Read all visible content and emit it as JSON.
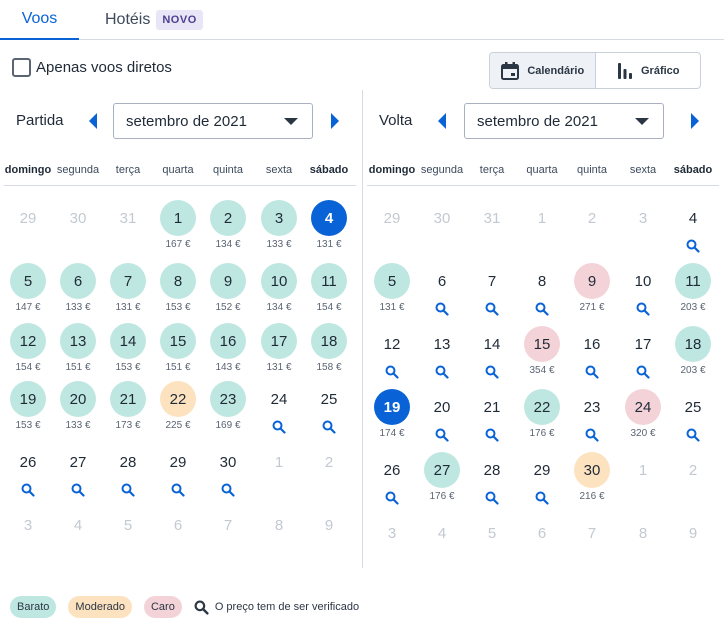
{
  "tabs": [
    {
      "label": "Voos",
      "active": true
    },
    {
      "label": "Hotéis",
      "badge": "NOVO",
      "active": false
    }
  ],
  "filters": {
    "direct_only_label": "Apenas voos diretos",
    "direct_only_checked": false
  },
  "view_toggle": [
    {
      "label": "Calendário",
      "icon": "calendar-icon",
      "active": true
    },
    {
      "label": "Gráfico",
      "icon": "bar-chart-icon",
      "active": false
    }
  ],
  "weekdays": [
    "domingo",
    "segunda",
    "terça",
    "quarta",
    "quinta",
    "sexta",
    "sábado"
  ],
  "departure": {
    "label": "Partida",
    "month": "setembro de 2021",
    "weeks": [
      [
        {
          "d": "29",
          "out": true
        },
        {
          "d": "30",
          "out": true
        },
        {
          "d": "31",
          "out": true
        },
        {
          "d": "1",
          "p": "167 €",
          "c": "cheap"
        },
        {
          "d": "2",
          "p": "134 €",
          "c": "cheap"
        },
        {
          "d": "3",
          "p": "133 €",
          "c": "cheap"
        },
        {
          "d": "4",
          "p": "131 €",
          "c": "selected"
        }
      ],
      [
        {
          "d": "5",
          "p": "147 €",
          "c": "cheap"
        },
        {
          "d": "6",
          "p": "133 €",
          "c": "cheap"
        },
        {
          "d": "7",
          "p": "131 €",
          "c": "cheap"
        },
        {
          "d": "8",
          "p": "153 €",
          "c": "cheap"
        },
        {
          "d": "9",
          "p": "152 €",
          "c": "cheap"
        },
        {
          "d": "10",
          "p": "134 €",
          "c": "cheap"
        },
        {
          "d": "11",
          "p": "154 €",
          "c": "cheap"
        }
      ],
      [
        {
          "d": "12",
          "p": "154 €",
          "c": "cheap"
        },
        {
          "d": "13",
          "p": "151 €",
          "c": "cheap"
        },
        {
          "d": "14",
          "p": "153 €",
          "c": "cheap"
        },
        {
          "d": "15",
          "p": "151 €",
          "c": "cheap"
        },
        {
          "d": "16",
          "p": "143 €",
          "c": "cheap"
        },
        {
          "d": "17",
          "p": "131 €",
          "c": "cheap"
        },
        {
          "d": "18",
          "p": "158 €",
          "c": "cheap"
        }
      ],
      [
        {
          "d": "19",
          "p": "153 €",
          "c": "cheap"
        },
        {
          "d": "20",
          "p": "133 €",
          "c": "cheap"
        },
        {
          "d": "21",
          "p": "173 €",
          "c": "cheap"
        },
        {
          "d": "22",
          "p": "225 €",
          "c": "moderate"
        },
        {
          "d": "23",
          "p": "169 €",
          "c": "cheap"
        },
        {
          "d": "24",
          "s": true
        },
        {
          "d": "25",
          "s": true
        }
      ],
      [
        {
          "d": "26",
          "s": true
        },
        {
          "d": "27",
          "s": true
        },
        {
          "d": "28",
          "s": true
        },
        {
          "d": "29",
          "s": true
        },
        {
          "d": "30",
          "s": true
        },
        {
          "d": "1",
          "out": true
        },
        {
          "d": "2",
          "out": true
        }
      ],
      [
        {
          "d": "3",
          "out": true
        },
        {
          "d": "4",
          "out": true
        },
        {
          "d": "5",
          "out": true
        },
        {
          "d": "6",
          "out": true
        },
        {
          "d": "7",
          "out": true
        },
        {
          "d": "8",
          "out": true
        },
        {
          "d": "9",
          "out": true
        }
      ]
    ]
  },
  "return": {
    "label": "Volta",
    "month": "setembro de 2021",
    "weeks": [
      [
        {
          "d": "29",
          "out": true
        },
        {
          "d": "30",
          "out": true
        },
        {
          "d": "31",
          "out": true
        },
        {
          "d": "1",
          "out": true
        },
        {
          "d": "2",
          "out": true
        },
        {
          "d": "3",
          "out": true
        },
        {
          "d": "4",
          "s": true
        }
      ],
      [
        {
          "d": "5",
          "p": "131 €",
          "c": "cheap"
        },
        {
          "d": "6",
          "s": true
        },
        {
          "d": "7",
          "s": true
        },
        {
          "d": "8",
          "s": true
        },
        {
          "d": "9",
          "p": "271 €",
          "c": "expensive"
        },
        {
          "d": "10",
          "s": true
        },
        {
          "d": "11",
          "p": "203 €",
          "c": "cheap"
        }
      ],
      [
        {
          "d": "12",
          "s": true
        },
        {
          "d": "13",
          "s": true
        },
        {
          "d": "14",
          "s": true
        },
        {
          "d": "15",
          "p": "354 €",
          "c": "expensive"
        },
        {
          "d": "16",
          "s": true
        },
        {
          "d": "17",
          "s": true
        },
        {
          "d": "18",
          "p": "203 €",
          "c": "cheap"
        }
      ],
      [
        {
          "d": "19",
          "p": "174 €",
          "c": "selected"
        },
        {
          "d": "20",
          "s": true
        },
        {
          "d": "21",
          "s": true
        },
        {
          "d": "22",
          "p": "176 €",
          "c": "cheap"
        },
        {
          "d": "23",
          "s": true
        },
        {
          "d": "24",
          "p": "320 €",
          "c": "expensive"
        },
        {
          "d": "25",
          "s": true
        }
      ],
      [
        {
          "d": "26",
          "s": true
        },
        {
          "d": "27",
          "p": "176 €",
          "c": "cheap"
        },
        {
          "d": "28",
          "s": true
        },
        {
          "d": "29",
          "s": true
        },
        {
          "d": "30",
          "p": "216 €",
          "c": "moderate"
        },
        {
          "d": "1",
          "out": true
        },
        {
          "d": "2",
          "out": true
        }
      ],
      [
        {
          "d": "3",
          "out": true
        },
        {
          "d": "4",
          "out": true
        },
        {
          "d": "5",
          "out": true
        },
        {
          "d": "6",
          "out": true
        },
        {
          "d": "7",
          "out": true
        },
        {
          "d": "8",
          "out": true
        },
        {
          "d": "9",
          "out": true
        }
      ]
    ]
  },
  "legend": {
    "cheap": "Barato",
    "moderate": "Moderado",
    "expensive": "Caro",
    "note": "O preço tem de ser verificado"
  },
  "colors": {
    "accent": "#0a63d6",
    "cheap": "#bfe7e1",
    "moderate": "#fde2bf",
    "expensive": "#f3d3d7"
  }
}
